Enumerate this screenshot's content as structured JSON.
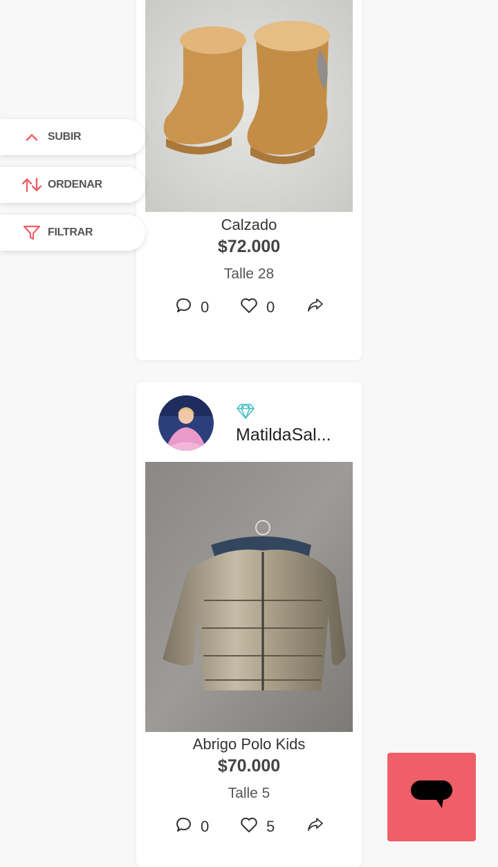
{
  "sidebar": {
    "upload_label": "SUBIR",
    "sort_label": "ORDENAR",
    "filter_label": "FILTRAR"
  },
  "products": [
    {
      "title": "Calzado",
      "price": "$72.000",
      "size": "Talle 28",
      "comments": "0",
      "likes": "0"
    },
    {
      "seller": "MatildaSal...",
      "title": "Abrigo Polo Kids",
      "price": "$70.000",
      "size": "Talle 5",
      "comments": "0",
      "likes": "5"
    }
  ],
  "icons": {
    "upload": "chevron-up-icon",
    "sort": "sort-arrows-icon",
    "filter": "filter-icon",
    "comment": "comment-icon",
    "like": "heart-icon",
    "share": "share-icon",
    "seller_badge": "diamond-icon",
    "chat": "chat-icon"
  },
  "colors": {
    "accent": "#ef5f67",
    "gem": "#3fbfc4"
  }
}
